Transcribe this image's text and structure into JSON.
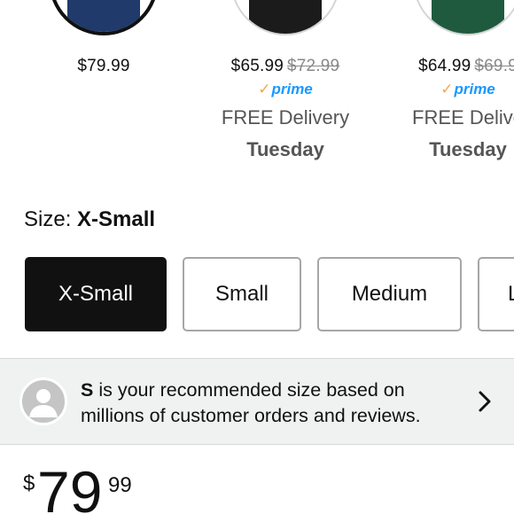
{
  "colors": {
    "accent_selected": "#111111",
    "prime_blue": "#1a98ff",
    "prime_check": "#f3a847",
    "muted_text": "#555555",
    "strike_text": "#888888",
    "banner_bg": "#f0f2f2"
  },
  "swatches": [
    {
      "color_hex": "#1f3a6b",
      "selected": true,
      "price": "$79.99",
      "was_price": "",
      "prime": false,
      "delivery": "",
      "delivery_day": ""
    },
    {
      "color_hex": "#1b1b1b",
      "selected": false,
      "price": "$65.99",
      "was_price": "$72.99",
      "prime": true,
      "delivery": "FREE Delivery",
      "delivery_day": "Tuesday"
    },
    {
      "color_hex": "#1f5a3e",
      "selected": false,
      "price": "$64.99",
      "was_price": "$69.9",
      "prime": true,
      "delivery": "FREE Delive",
      "delivery_day": "Tuesday"
    }
  ],
  "prime_label": "prime",
  "prime_check": "✓",
  "size": {
    "label": "Size:",
    "selected_value": "X-Small",
    "options": [
      "X-Small",
      "Small",
      "Medium",
      "L"
    ]
  },
  "recommendation": {
    "size": "S",
    "text": " is your recommended size based on millions of customer orders and reviews.",
    "icon": "person-icon",
    "chevron_icon": "chevron-right-icon"
  },
  "price": {
    "currency": "$",
    "whole": "79",
    "fraction": "99"
  }
}
